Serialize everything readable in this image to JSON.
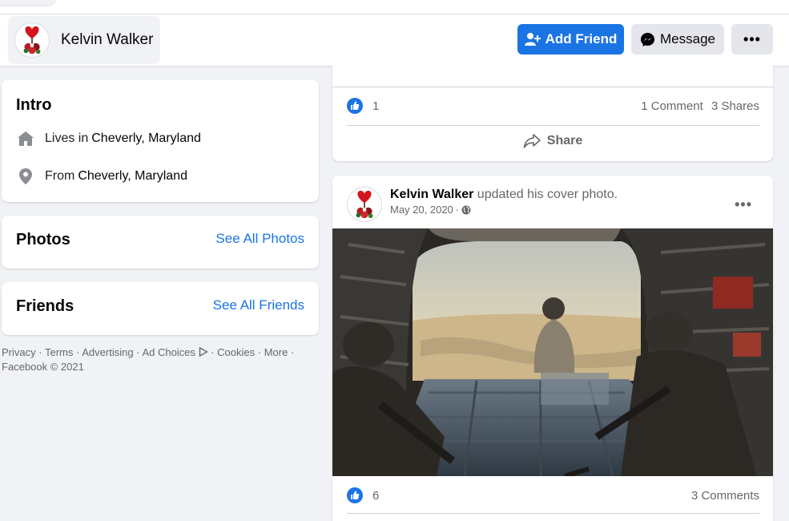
{
  "profile": {
    "name": "Kelvin Walker",
    "add_friend_label": "Add Friend",
    "message_label": "Message",
    "more_label": "•••"
  },
  "intro": {
    "title": "Intro",
    "lives_prefix": "Lives in",
    "lives_place": "Cheverly, Maryland",
    "from_prefix": "From",
    "from_place": "Cheverly, Maryland"
  },
  "photos": {
    "title": "Photos",
    "link": "See All Photos"
  },
  "friends": {
    "title": "Friends",
    "link": "See All Friends"
  },
  "footer": {
    "privacy": "Privacy",
    "terms": "Terms",
    "advertising": "Advertising",
    "ad_choices": "Ad Choices",
    "cookies": "Cookies",
    "more": "More",
    "copyright": "Facebook © 2021",
    "sep": "·"
  },
  "post1": {
    "likes": "1",
    "comments": "1 Comment",
    "shares": "3 Shares",
    "share_label": "Share"
  },
  "post2": {
    "author": "Kelvin Walker",
    "action": "updated his cover photo.",
    "date": "May 20, 2020",
    "date_sep": "·",
    "menu": "•••",
    "likes": "6",
    "comments": "3 Comments"
  },
  "colors": {
    "accent": "#1b74e4",
    "page_bg": "#f0f2f5",
    "secondary_text": "#65676b"
  },
  "icons": {
    "add_friend": "person-plus-icon",
    "message": "messenger-icon",
    "home": "home-icon",
    "location": "location-pin-icon",
    "like": "like-thumb-icon",
    "share": "share-arrow-icon",
    "globe": "globe-icon",
    "ad_choices": "ad-choices-icon"
  }
}
